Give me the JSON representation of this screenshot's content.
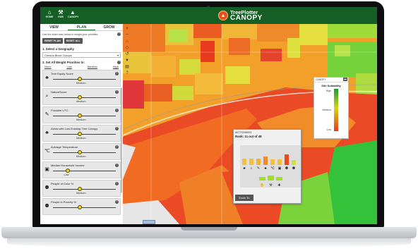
{
  "topbar": {
    "nav": [
      {
        "label": "HOME",
        "icon": "home-icon"
      },
      {
        "label": "HUB",
        "icon": "tools-icon"
      },
      {
        "label": "CANOPY",
        "icon": "tree-icon"
      }
    ],
    "brand_top": "TreePlotter",
    "brand_bottom": "CANOPY"
  },
  "sidebar": {
    "tabs": [
      "VIEW",
      "PLAN",
      "GROW"
    ],
    "active_tab": "PLAN",
    "hint": "Use the slider bars below to weight your priorities.",
    "reset_plan": "RESET PLAN",
    "reset_all": "RESET ALL",
    "geography_title": "1. Select a Geography",
    "geography_value": "Census Block Groups",
    "weights_title": "2. Set All Weight Priorities to:",
    "levels": [
      "None",
      "Low",
      "Medium",
      "High"
    ],
    "criteria": [
      {
        "label": "Tree Equity Score",
        "value": "Medium",
        "level": 0.5,
        "icon": "tree-icon"
      },
      {
        "label": "NatureScore",
        "value": "Medium",
        "level": 0.5,
        "icon": "magnifier-leaf-icon"
      },
      {
        "label": "Possible UTC",
        "value": "Medium",
        "level": 0.5,
        "icon": "pencil-tree-icon"
      },
      {
        "label": "Areas with Low Existing Tree Canopy",
        "value": "Medium",
        "level": 0.5,
        "icon": "tree-icon"
      },
      {
        "label": "Average Temperature",
        "value": "Medium",
        "level": 0.5,
        "icon": "thermometer-icon"
      },
      {
        "label": "Median Household Income",
        "value": "Low",
        "level": 0.25,
        "icon": "money-icon"
      },
      {
        "label": "People of Color %",
        "value": "Medium",
        "level": 0.5,
        "icon": "people-icon"
      },
      {
        "label": "People in Poverty %",
        "value": "",
        "level": 0.5,
        "icon": "people-icon"
      }
    ]
  },
  "legend": {
    "header": "CANOPY",
    "title": "Site Suitability",
    "high": "High",
    "medium": "Medium",
    "low": "Low",
    "colors": [
      "#1a9c33",
      "#d5d318",
      "#e93a1f"
    ]
  },
  "popup": {
    "id": "80770338003",
    "rank": "Rank: 11 out of 48",
    "zoom_label": "Zoom To",
    "bars_top": [
      {
        "value": 0.55,
        "color": "#f2c03a",
        "icon": "tree-icon"
      },
      {
        "value": 0.55,
        "color": "#f2c03a",
        "icon": "magnifier-leaf-icon"
      },
      {
        "value": 0.55,
        "color": "#f2b236",
        "icon": "pencil-tree-icon"
      },
      {
        "value": 0.75,
        "color": "#f28a2a",
        "icon": "tree-icon"
      },
      {
        "value": 0.5,
        "color": "#f2c03a",
        "icon": "thermometer-icon"
      },
      {
        "value": 0.5,
        "color": "#f2c03a",
        "icon": "money-icon"
      },
      {
        "value": 0.95,
        "color": "#e84a1a",
        "icon": "people-icon"
      },
      {
        "value": 0.45,
        "color": "#d4e03a",
        "icon": "people-icon"
      }
    ],
    "bars_bottom": [
      {
        "value": 0.3,
        "icon": "hand-icon"
      },
      {
        "value": 0.45,
        "icon": "broom-icon"
      },
      {
        "value": 0.3,
        "icon": "plus-icon"
      }
    ]
  }
}
